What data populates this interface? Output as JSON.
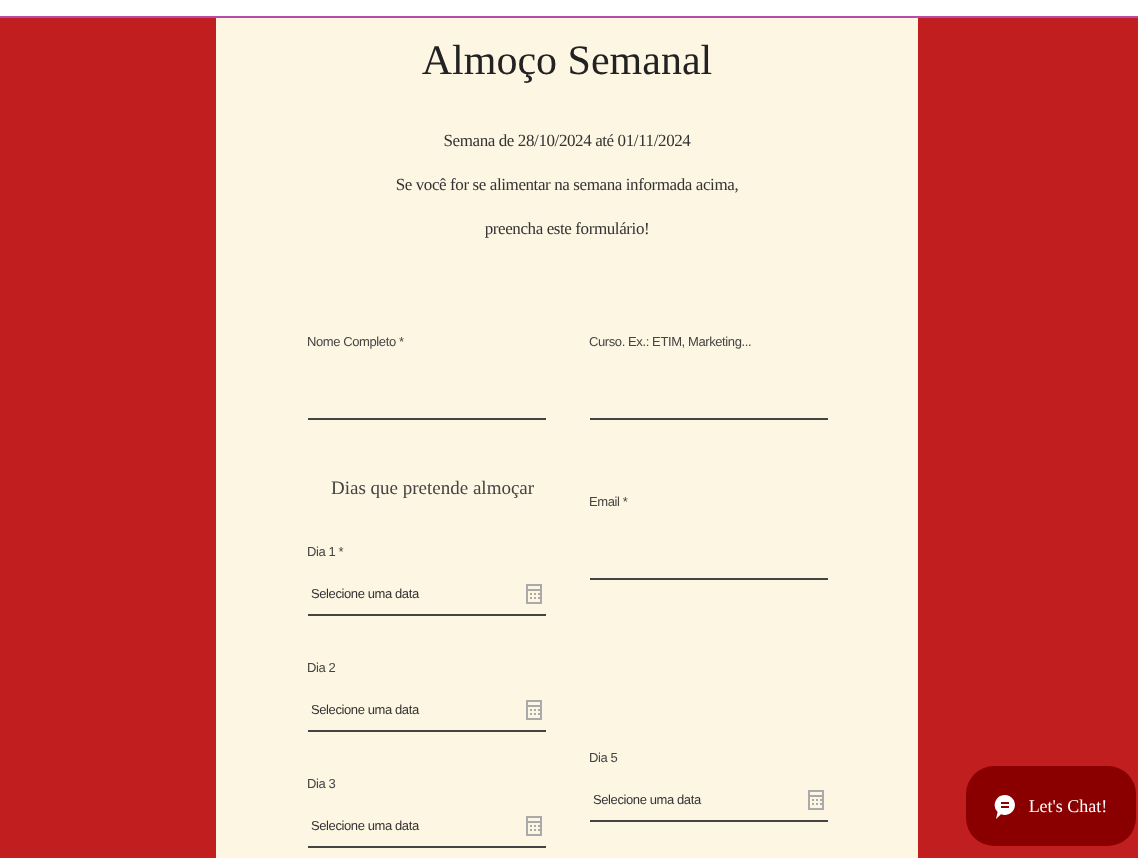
{
  "form": {
    "title": "Almoço Semanal",
    "intro": [
      "Semana de 28/10/2024 até 01/11/2024",
      "Se você for se alimentar na semana informada acima,",
      "preencha este formulário!"
    ],
    "left_column": [
      {
        "kind": "text",
        "label": "Nome Completo *"
      },
      {
        "kind": "heading",
        "label": "Dias que pretende almoçar"
      },
      {
        "kind": "date",
        "label": "Dia 1 *",
        "placeholder": "Selecione uma data"
      },
      {
        "kind": "date",
        "label": "Dia 2",
        "placeholder": "Selecione uma data"
      },
      {
        "kind": "date",
        "label": "Dia 3",
        "placeholder": "Selecione uma data"
      }
    ],
    "right_column": [
      {
        "kind": "text",
        "label": "Curso. Ex.: ETIM, Marketing..."
      },
      {
        "kind": "text",
        "label": "Email *"
      },
      {
        "kind": "spacer"
      },
      {
        "kind": "date",
        "label": "Dia 5",
        "placeholder": "Selecione uma data"
      }
    ]
  },
  "chat_button": {
    "label": "Let's Chat!"
  }
}
